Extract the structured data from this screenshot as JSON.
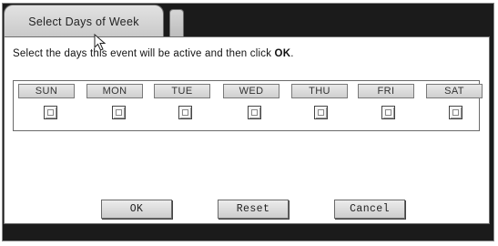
{
  "tab": {
    "active_label": "Select Days of Week"
  },
  "instruction": {
    "text": "Select the days this event will be active and then click ",
    "strong": "OK",
    "end": "."
  },
  "days": [
    {
      "label": "SUN",
      "checked": false
    },
    {
      "label": "MON",
      "checked": false
    },
    {
      "label": "TUE",
      "checked": false
    },
    {
      "label": "WED",
      "checked": false
    },
    {
      "label": "THU",
      "checked": false
    },
    {
      "label": "FRI",
      "checked": false
    },
    {
      "label": "SAT",
      "checked": false
    }
  ],
  "buttons": {
    "ok": "OK",
    "reset": "Reset",
    "cancel": "Cancel"
  },
  "colors": {
    "frame": "#1b1b1b",
    "panel": "#ffffff",
    "button_face": "#dcdcdc"
  }
}
